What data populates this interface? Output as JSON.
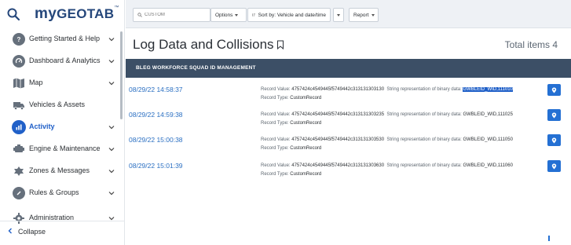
{
  "sidebar": {
    "logo_prefix": "my",
    "logo_main": "GEOTAB",
    "logo_tm": "™",
    "items": [
      {
        "label": "Getting Started & Help",
        "icon": "help-icon"
      },
      {
        "label": "Dashboard & Analytics",
        "icon": "dashboard-icon"
      },
      {
        "label": "Map",
        "icon": "map-icon"
      },
      {
        "label": "Vehicles & Assets",
        "icon": "truck-icon"
      },
      {
        "label": "Activity",
        "icon": "activity-chart-icon",
        "active": true
      },
      {
        "label": "Engine & Maintenance",
        "icon": "engine-icon"
      },
      {
        "label": "Zones & Messages",
        "icon": "zones-icon"
      },
      {
        "label": "Rules & Groups",
        "icon": "rules-icon"
      },
      {
        "label": "Administration",
        "icon": "gear-icon"
      }
    ],
    "collapse_label": "Collapse"
  },
  "toolbar": {
    "search_placeholder": "CUSTOM",
    "options_label": "Options",
    "sort_label": "Sort by: Vehicle and date/time",
    "report_label": "Report"
  },
  "main": {
    "title": "Log Data and Collisions",
    "total_items": "Total items 4",
    "group_header": "BLEG WORKFORCE SQUAD ID MANAGEMENT",
    "record_value_label": "Record Value:",
    "string_rep_label": "String representation of binary data:",
    "record_type_label": "Record Type:",
    "rows": [
      {
        "date": "08/29/22 14:58:37",
        "record_value": "4757424c4549445f5749442c313131303130",
        "string_rep": "GWBLEID_WID,111010",
        "record_type": "CustomRecord",
        "selected": true
      },
      {
        "date": "08/29/22 14:59:38",
        "record_value": "4757424c4549445f5749442c313131303235",
        "string_rep": "GWBLEID_WID,111025",
        "record_type": "CustomRecord"
      },
      {
        "date": "08/29/22 15:00:38",
        "record_value": "4757424c4549445f5749442c313131303530",
        "string_rep": "GWBLEID_WID,111050",
        "record_type": "CustomRecord"
      },
      {
        "date": "08/29/22 15:01:39",
        "record_value": "4757424c4549445f5749442c313131303630",
        "string_rep": "GWBLEID_WID,111060",
        "record_type": "CustomRecord"
      }
    ]
  },
  "colors": {
    "brand": "#25477b",
    "accent": "#2470d3",
    "group_header_bg": "#3c4f66",
    "selection": "#2060c8"
  }
}
